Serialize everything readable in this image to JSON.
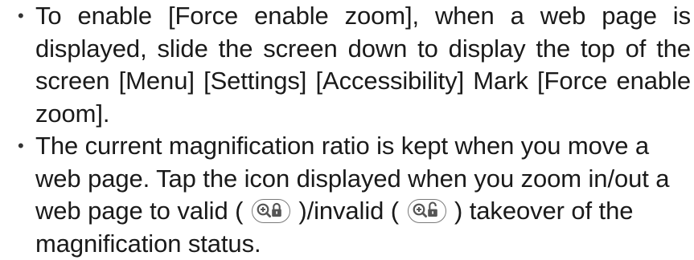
{
  "notes": [
    {
      "text": "To enable [Force enable zoom], when a web page is displayed, slide the screen down to display the top of the screen [Menu] [Settings] [Accessibility] Mark [Force enable zoom]."
    },
    {
      "text_before": "The current magnification ratio is kept when you move a web page. Tap the icon displayed when you zoom in/out a web page to valid ( ",
      "text_middle": " )/invalid ( ",
      "text_after": " ) takeover of the magnification status.",
      "icons": {
        "valid": "zoom-locked-icon",
        "invalid": "zoom-unlocked-icon"
      }
    }
  ],
  "colors": {
    "text": "#1a1a1a",
    "icon": "#555555"
  }
}
